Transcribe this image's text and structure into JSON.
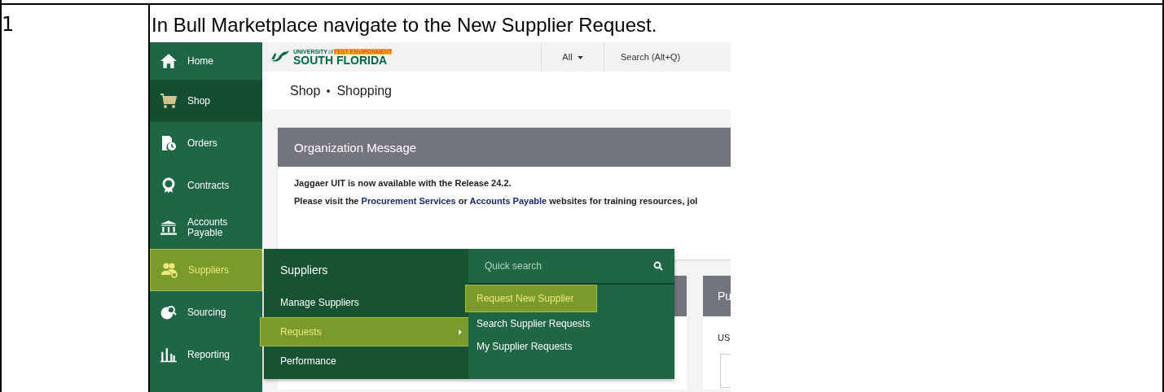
{
  "document": {
    "step_number": "1",
    "instruction": "In Bull Marketplace navigate to the New Supplier Request."
  },
  "app": {
    "logo": {
      "top": "UNIVERSITY",
      "of": "of",
      "badge": "TEST ENVIRONMENT",
      "name": "SOUTH FLORIDA"
    },
    "search_scope": "All",
    "search_placeholder": "Search (Alt+Q)",
    "breadcrumb": [
      "Shop",
      "Shopping"
    ],
    "sidebar": [
      {
        "label": "Home",
        "current": false,
        "selected": false
      },
      {
        "label": "Shop",
        "current": true,
        "selected": false
      },
      {
        "label": "Orders",
        "current": false,
        "selected": false
      },
      {
        "label": "Contracts",
        "current": false,
        "selected": false
      },
      {
        "label": "Accounts Payable",
        "current": false,
        "selected": false
      },
      {
        "label": "Suppliers",
        "current": false,
        "selected": true
      },
      {
        "label": "Sourcing",
        "current": false,
        "selected": false
      },
      {
        "label": "Reporting",
        "current": false,
        "selected": false
      }
    ],
    "message_card": {
      "title": "Organization Message",
      "line_1": "Jaggaer UIT is now available with the Release 24.2.",
      "line_2_start": "Please visit the",
      "link_1": "Procurement Services",
      "line_2_mid": "or",
      "link_2": "Accounts Payable",
      "line_2_end": "websites for training resources, jol"
    },
    "right_card": {
      "title": "Pu",
      "label": "US"
    },
    "flyout": {
      "title": "Suppliers",
      "items": [
        {
          "label": "Manage Suppliers",
          "selected": false,
          "submenu": false
        },
        {
          "label": "Requests",
          "selected": true,
          "submenu": true
        },
        {
          "label": "Performance",
          "selected": false,
          "submenu": false
        }
      ],
      "quick_search_placeholder": "Quick search",
      "subitems": [
        {
          "label": "Request New Supplier",
          "selected": true
        },
        {
          "label": "Search Supplier Requests",
          "selected": false
        },
        {
          "label": "My Supplier Requests",
          "selected": false
        }
      ]
    }
  }
}
